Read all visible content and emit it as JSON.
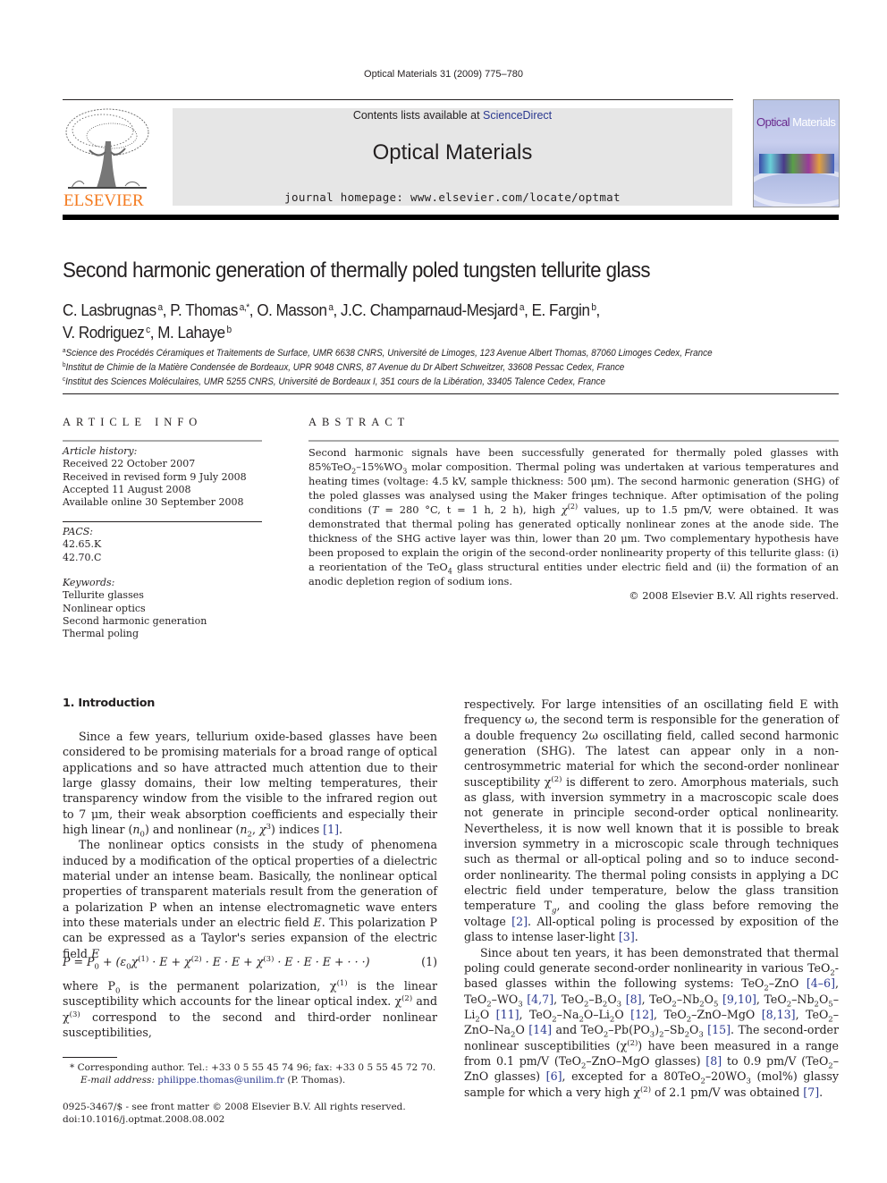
{
  "running_head": "Optical Materials 31 (2009) 775–780",
  "banner": {
    "contents_prefix": "Contents lists available at",
    "contents_link": "ScienceDirect",
    "journal_title": "Optical Materials",
    "homepage": "journal homepage: www.elsevier.com/locate/optmat"
  },
  "logo": {
    "publisher": "ELSEVIER",
    "icon": "elsevier-tree-icon",
    "color": "#f47b20"
  },
  "cover": {
    "title_part1": "Optical",
    "title_part2": "Materials"
  },
  "article": {
    "title": "Second harmonic generation of thermally poled tungsten tellurite glass",
    "authors_line1": [
      {
        "name": "C. Lasbrugnas",
        "sup": "a",
        "sep": ", "
      },
      {
        "name": "P. Thomas",
        "sup": "a,*",
        "sep": ", "
      },
      {
        "name": "O. Masson",
        "sup": "a",
        "sep": ", "
      },
      {
        "name": "J.C. Champarnaud-Mesjard",
        "sup": "a",
        "sep": ", "
      },
      {
        "name": "E. Fargin",
        "sup": "b",
        "sep": ","
      }
    ],
    "authors_line2": [
      {
        "name": "V. Rodriguez",
        "sup": "c",
        "sep": ", "
      },
      {
        "name": "M. Lahaye",
        "sup": "b",
        "sep": ""
      }
    ],
    "affiliations": [
      {
        "sup": "a",
        "text": "Science des Procédés Céramiques et Traitements de Surface, UMR 6638 CNRS, Université de Limoges, 123 Avenue Albert Thomas, 87060 Limoges Cedex, France"
      },
      {
        "sup": "b",
        "text": "Institut de Chimie de la Matière Condensée de Bordeaux, UPR 9048 CNRS, 87 Avenue du Dr Albert Schweitzer, 33608 Pessac Cedex, France"
      },
      {
        "sup": "c",
        "text": "Institut des Sciences Moléculaires, UMR 5255 CNRS, Université de Bordeaux I, 351 cours de la Libération, 33405 Talence Cedex, France"
      }
    ]
  },
  "article_info": {
    "heading": "ARTICLE INFO",
    "history_label": "Article history:",
    "history": [
      "Received 22 October 2007",
      "Received in revised form 9 July 2008",
      "Accepted 11 August 2008",
      "Available online 30 September 2008"
    ],
    "pacs_label": "PACS:",
    "pacs": [
      "42.65.K",
      "42.70.C"
    ],
    "keywords_label": "Keywords:",
    "keywords": [
      "Tellurite glasses",
      "Nonlinear optics",
      "Second harmonic generation",
      "Thermal poling"
    ]
  },
  "abstract": {
    "heading": "ABSTRACT",
    "s1": "Second harmonic signals have been successfully generated for thermally poled glasses with 85%TeO",
    "s2": "–15%WO",
    "s3": " molar composition. Thermal poling was undertaken at various temperatures and heating times (voltage: 4.5 kV, sample thickness: 500 μm). The second harmonic generation (SHG) of the poled glasses was analysed using the Maker fringes technique. After optimisation of the poling conditions (",
    "s4": " = 280 °C, t = 1 h, 2 h), high ",
    "s5": " values, up to 1.5 pm/V, were obtained. It was demonstrated that thermal poling has generated optically nonlinear zones at the anode side. The thickness of the SHG active layer was thin, lower than 20 μm. Two complementary hypothesis have been proposed to explain the origin of the second-order nonlinearity property of this tellurite glass: (i) a reorientation of the TeO",
    "s6": " glass structural entities under electric field and (ii) the formation of an anodic depletion region of sodium ions.",
    "copyright": "© 2008 Elsevier B.V. All rights reserved."
  },
  "intro": {
    "heading": "1. Introduction",
    "p1a": "Since a few years, tellurium oxide-based glasses have been considered to be promising materials for a broad range of optical applications and so have attracted much attention due to their large glassy domains, their low melting temperatures, their transparency window from the visible to the infrared region out to 7 μm, their weak absorption coefficients and especially their high linear (",
    "p1b": ") and nonlinear (",
    "p1c": ") indices ",
    "ref1": "[1]",
    "p2": "The nonlinear optics consists in the study of phenomena induced by a modification of the optical properties of a dielectric material under an intense beam. Basically, the nonlinear optical properties of transparent materials result from the generation of a polarization P when an intense electromagnetic wave enters into these materials under an electric field E. This polarization P can be expressed as a Taylor's series expansion of the electric field E",
    "equation_number": "(1)",
    "p3a": "where P",
    "p3b": " is the permanent polarization, χ",
    "p3c": " is the linear susceptibility which accounts for the linear optical index. χ",
    "p3d": " and χ",
    "p3e": " correspond to the second and third-order nonlinear susceptibilities,",
    "r1": "respectively. For large intensities of an oscillating field E with frequency ω, the second term is responsible for the generation of a double frequency 2ω oscillating field, called second harmonic generation (SHG). The latest can appear only in a non-centrosymmetric material for which the second-order nonlinear susceptibility χ",
    "r2": " is different to zero. Amorphous materials, such as glass, with inversion symmetry in a macroscopic scale does not generate in principle second-order optical nonlinearity. Nevertheless, it is now well known that it is possible to break inversion symmetry in a microscopic scale through techniques such as thermal or all-optical poling and so to induce second-order nonlinearity. The thermal poling consists in applying a DC electric field under temperature, below the glass transition temperature T",
    "r3": ", and cooling the glass before removing the voltage ",
    "ref2": "[2]",
    "r4": ". All-optical poling is processed by exposition of the glass to intense laser-light ",
    "ref3": "[3]",
    "r5": "Since about ten years, it has been demonstrated that thermal poling could generate second-order nonlinearity in various TeO",
    "r6": "-based glasses within the following systems: ",
    "refs": {
      "r4_6": "[4–6]",
      "r4_7": "[4,7]",
      "r8": "[8]",
      "r9_10": "[9,10]",
      "r11": "[11]",
      "r12": "[12]",
      "r8_13": "[8,13]",
      "r14": "[14]",
      "r15": "[15]",
      "r8b": "[8]",
      "r6": "[6]",
      "r7": "[7]"
    },
    "r7": "The second-order nonlinear susceptibilities (χ",
    "r8": ") have been measured in a range from 0.1 pm/V (TeO",
    "r9": "–ZnO–MgO glasses) ",
    "r10": " to 0.9 pm/V (TeO",
    "r11": "–ZnO glasses) ",
    "r12": ", excepted for a 80TeO",
    "r13": "–20WO",
    "r14": " (mol%) glassy sample for which a very high χ",
    "r15": " of 2.1 pm/V was obtained "
  },
  "footnote": {
    "corresponding": "* Corresponding author. Tel.: +33 0 5 55 45 74 96; fax: +33 0 5 55 45 72 70.",
    "email_label": "E-mail address:",
    "email": "philippe.thomas@unilim.fr",
    "email_suffix": " (P. Thomas)."
  },
  "frontmatter": {
    "issn": "0925-3467/$ - see front matter © 2008 Elsevier B.V. All rights reserved.",
    "doi": "doi:10.1016/j.optmat.2008.08.002"
  },
  "colors": {
    "link": "#2b3990",
    "elsevier_orange": "#f47b20",
    "banner_gray": "#e6e6e6"
  }
}
